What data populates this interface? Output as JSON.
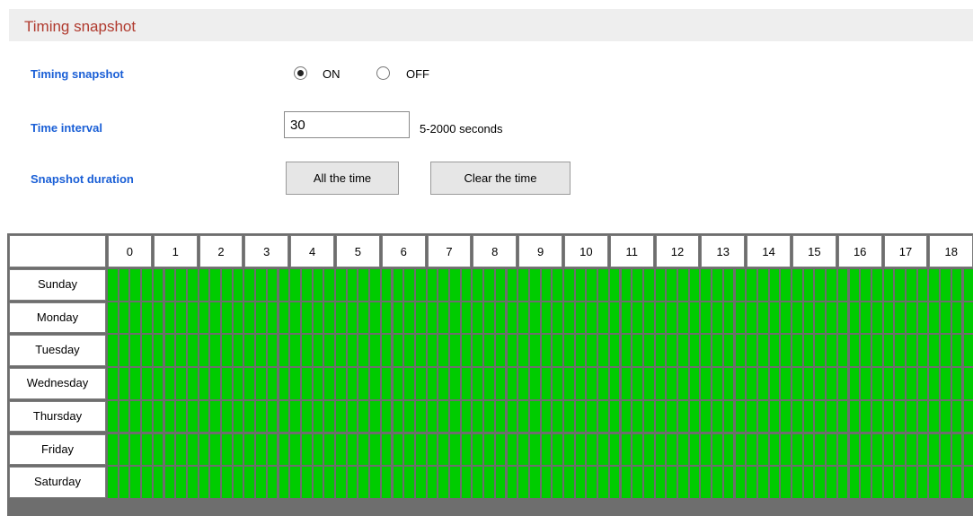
{
  "header": {
    "title": "Timing snapshot"
  },
  "form": {
    "timing_snapshot": {
      "label": "Timing snapshot",
      "options": [
        {
          "label": "ON",
          "checked": true
        },
        {
          "label": "OFF",
          "checked": false
        }
      ]
    },
    "time_interval": {
      "label": "Time interval",
      "value": "30",
      "hint": "5-2000 seconds"
    },
    "snapshot_duration": {
      "label": "Snapshot duration",
      "buttons": [
        "All the time",
        "Clear the time"
      ]
    }
  },
  "schedule": {
    "hours": [
      "0",
      "1",
      "2",
      "3",
      "4",
      "5",
      "6",
      "7",
      "8",
      "9",
      "10",
      "11",
      "12",
      "13",
      "14",
      "15",
      "16",
      "17",
      "18"
    ],
    "days": [
      "Sunday",
      "Monday",
      "Tuesday",
      "Wednesday",
      "Thursday",
      "Friday",
      "Saturday"
    ],
    "slots_per_hour": 4,
    "all_slots_selected": true,
    "selected_color": "#00cc00"
  },
  "colors": {
    "title": "#b03a2e",
    "label": "#1a5fd6",
    "title_bar_bg": "#eeeeee"
  }
}
